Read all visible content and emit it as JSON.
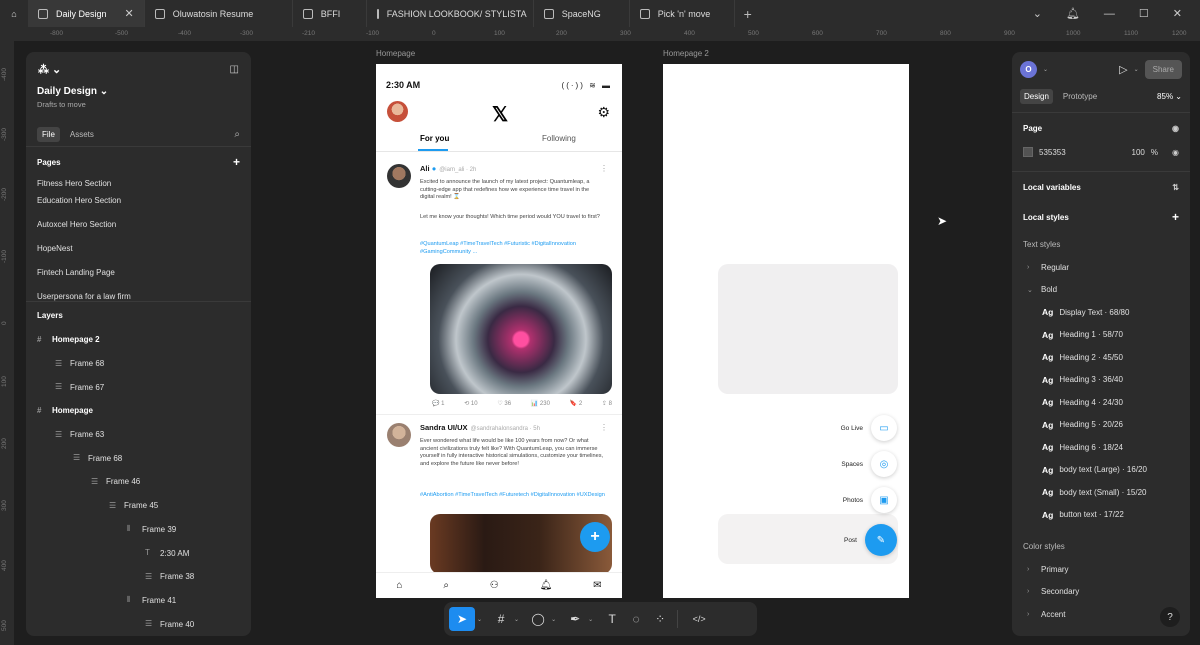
{
  "tabs": [
    {
      "label": "Daily Design",
      "active": true
    },
    {
      "label": "Oluwatosin Resume"
    },
    {
      "label": "BFFI"
    },
    {
      "label": "FASHION LOOKBOOK/ STYLISTA"
    },
    {
      "label": "SpaceNG"
    },
    {
      "label": "Pick 'n' move"
    }
  ],
  "ruler": {
    "h": [
      "-800",
      "-600",
      "-500",
      "-400",
      "-300",
      "-210",
      "-100",
      "0",
      "100",
      "200",
      "300",
      "400",
      "500",
      "600",
      "700",
      "800",
      "900",
      "1000",
      "1100",
      "1200"
    ],
    "v": [
      "-400",
      "-300",
      "-200",
      "-100",
      "0",
      "100",
      "200",
      "300",
      "400",
      "500",
      "600"
    ]
  },
  "left": {
    "project_title": "Daily Design",
    "project_sub": "Drafts to move",
    "file_tab": "File",
    "assets_tab": "Assets",
    "pages_label": "Pages",
    "pages": [
      "Fitness Hero Section",
      "Education Hero Section",
      "Autoxcel Hero Section",
      "HopeNest",
      "Fintech Landing Page",
      "Userpersona for a law firm"
    ],
    "layers_label": "Layers",
    "layers": [
      {
        "label": "Homepage 2",
        "indent": 0,
        "bold": true
      },
      {
        "label": "Frame 68",
        "indent": 1
      },
      {
        "label": "Frame 67",
        "indent": 1
      },
      {
        "label": "Homepage",
        "indent": 0,
        "bold": true
      },
      {
        "label": "Frame 63",
        "indent": 1
      },
      {
        "label": "Frame 68",
        "indent": 2
      },
      {
        "label": "Frame 46",
        "indent": 3
      },
      {
        "label": "Frame 45",
        "indent": 4
      },
      {
        "label": "Frame 39",
        "indent": 5
      },
      {
        "label": "2:30 AM",
        "indent": 6,
        "text": true
      },
      {
        "label": "Frame 38",
        "indent": 6
      },
      {
        "label": "Frame 41",
        "indent": 5
      },
      {
        "label": "Frame 40",
        "indent": 6
      }
    ]
  },
  "frames": {
    "homepage_label": "Homepage",
    "homepage2_label": "Homepage 2",
    "status_time": "2:30 AM",
    "status_icons": "((·)) ≋ ▬",
    "tab_for_you": "For you",
    "tab_following": "Following",
    "tweet1": {
      "name": "Ali",
      "handle": "@iam_ali · 2h",
      "body": "Excited to announce the launch of my latest project: Quantumleap, a cutting-edge app that redefines how we experience time travel in the digital realm! ⌛",
      "body2": "Let me know your thoughts! Which time period would YOU travel to first?",
      "tags": "#QuantumLeap #TimeTravelTech #Futuristic #DigitalInnovation #GamingCommunity ...",
      "actions": [
        "💬 1",
        "⟲ 10",
        "♡ 36",
        "📊 230",
        "🔖 2",
        "⇪ 8"
      ]
    },
    "tweet2": {
      "name": "Sandra UI/UX",
      "handle": "@sandrahalonsandra · 5h",
      "body": "Ever wondered what life would be like 100 years from now? Or what ancient civilizations truly felt like? With QuantumLeap, you can immerse yourself in fully interactive historical simulations, customize your timelines, and explore the future like never before!",
      "tags": "#AntiAbortion #TimeTravelTech #Futuretech #DigitalInnovation #UXDesign"
    },
    "fab_plus": "+",
    "menu": [
      {
        "label": "Go Live",
        "icon": "▭"
      },
      {
        "label": "Spaces",
        "icon": "◎"
      },
      {
        "label": "Photos",
        "icon": "▣"
      },
      {
        "label": "Post",
        "icon": "✎"
      }
    ]
  },
  "right": {
    "avatar": "O",
    "share": "Share",
    "design_tab": "Design",
    "prototype_tab": "Prototype",
    "zoom": "85%",
    "page_label": "Page",
    "page_color": "535353",
    "page_opacity": "100",
    "pct": "%",
    "local_variables": "Local variables",
    "local_styles": "Local styles",
    "text_styles": "Text styles",
    "regular": "Regular",
    "bold": "Bold",
    "styles": [
      "Display Text · 68/80",
      "Heading 1 · 58/70",
      "Heading 2 · 45/50",
      "Heading 3 · 36/40",
      "Heading 4 · 24/30",
      "Heading 5 · 20/26",
      "Heading 6 · 18/24",
      "body text (Large) · 16/20",
      "body text (Small) · 15/20",
      "button text · 17/22"
    ],
    "color_styles": "Color styles",
    "colors": [
      "Primary",
      "Secondary",
      "Accent"
    ],
    "help": "?"
  },
  "colors": {
    "accent": "#1d9bf0",
    "selection": "#1d8cf0",
    "panel": "#2c2c2c",
    "canvas": "#1e1e1e"
  }
}
